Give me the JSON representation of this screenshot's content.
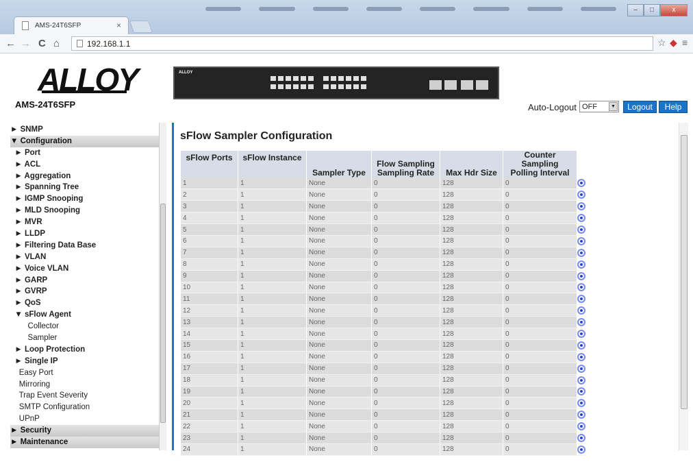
{
  "browser": {
    "tab_title": "AMS-24T6SFP",
    "tab_close": "×",
    "url": "192.168.1.1",
    "back_icon": "←",
    "forward_icon": "→",
    "reload_icon": "C",
    "home_icon": "⌂",
    "star_icon": "☆",
    "menu_icon": "≡",
    "win_min": "–",
    "win_max": "□",
    "win_close": "x"
  },
  "header": {
    "logo_text": "ALLOY",
    "model": "AMS-24T6SFP",
    "device_logo": "ALLOY",
    "autologout_label": "Auto-Logout",
    "autologout_value": "OFF",
    "logout_label": "Logout",
    "help_label": "Help"
  },
  "sidebar": {
    "items": [
      {
        "label": "► SNMP",
        "style": "b"
      },
      {
        "label": "▼ Configuration",
        "style": "b band"
      },
      {
        "label": "  ► Port",
        "style": "b"
      },
      {
        "label": "  ► ACL",
        "style": "b"
      },
      {
        "label": "  ► Aggregation",
        "style": "b"
      },
      {
        "label": "  ► Spanning Tree",
        "style": "b"
      },
      {
        "label": "  ► IGMP Snooping",
        "style": "b"
      },
      {
        "label": "  ► MLD Snooping",
        "style": "b"
      },
      {
        "label": "  ► MVR",
        "style": "b"
      },
      {
        "label": "  ► LLDP",
        "style": "b"
      },
      {
        "label": "  ► Filtering Data Base",
        "style": "b"
      },
      {
        "label": "  ► VLAN",
        "style": "b"
      },
      {
        "label": "  ► Voice VLAN",
        "style": "b"
      },
      {
        "label": "  ► GARP",
        "style": "b"
      },
      {
        "label": "  ► GVRP",
        "style": "b"
      },
      {
        "label": "  ► QoS",
        "style": "b"
      },
      {
        "label": "  ▼ sFlow Agent",
        "style": "b"
      },
      {
        "label": "        Collector",
        "style": ""
      },
      {
        "label": "        Sampler",
        "style": ""
      },
      {
        "label": "  ► Loop Protection",
        "style": "b"
      },
      {
        "label": "  ► Single IP",
        "style": "b"
      },
      {
        "label": "    Easy Port",
        "style": ""
      },
      {
        "label": "    Mirroring",
        "style": ""
      },
      {
        "label": "    Trap Event Severity",
        "style": ""
      },
      {
        "label": "    SMTP Configuration",
        "style": ""
      },
      {
        "label": "    UPnP",
        "style": ""
      },
      {
        "label": "► Security",
        "style": "b band"
      },
      {
        "label": "► Maintenance",
        "style": "b band"
      }
    ]
  },
  "main": {
    "title": "sFlow Sampler Configuration",
    "columns": [
      {
        "line1": "sFlow Ports",
        "line2": ""
      },
      {
        "line1": "sFlow Instance",
        "line2": ""
      },
      {
        "line1": "",
        "line2": "Sampler Type"
      },
      {
        "line1": "Flow Sampling",
        "line2": "Sampling Rate"
      },
      {
        "line1": "",
        "line2": "Max Hdr Size"
      },
      {
        "line1": "Counter Sampling",
        "line2": "Polling Interval"
      }
    ],
    "rows": [
      [
        "1",
        "1",
        "None",
        "0",
        "128",
        "0"
      ],
      [
        "2",
        "1",
        "None",
        "0",
        "128",
        "0"
      ],
      [
        "3",
        "1",
        "None",
        "0",
        "128",
        "0"
      ],
      [
        "4",
        "1",
        "None",
        "0",
        "128",
        "0"
      ],
      [
        "5",
        "1",
        "None",
        "0",
        "128",
        "0"
      ],
      [
        "6",
        "1",
        "None",
        "0",
        "128",
        "0"
      ],
      [
        "7",
        "1",
        "None",
        "0",
        "128",
        "0"
      ],
      [
        "8",
        "1",
        "None",
        "0",
        "128",
        "0"
      ],
      [
        "9",
        "1",
        "None",
        "0",
        "128",
        "0"
      ],
      [
        "10",
        "1",
        "None",
        "0",
        "128",
        "0"
      ],
      [
        "11",
        "1",
        "None",
        "0",
        "128",
        "0"
      ],
      [
        "12",
        "1",
        "None",
        "0",
        "128",
        "0"
      ],
      [
        "13",
        "1",
        "None",
        "0",
        "128",
        "0"
      ],
      [
        "14",
        "1",
        "None",
        "0",
        "128",
        "0"
      ],
      [
        "15",
        "1",
        "None",
        "0",
        "128",
        "0"
      ],
      [
        "16",
        "1",
        "None",
        "0",
        "128",
        "0"
      ],
      [
        "17",
        "1",
        "None",
        "0",
        "128",
        "0"
      ],
      [
        "18",
        "1",
        "None",
        "0",
        "128",
        "0"
      ],
      [
        "19",
        "1",
        "None",
        "0",
        "128",
        "0"
      ],
      [
        "20",
        "1",
        "None",
        "0",
        "128",
        "0"
      ],
      [
        "21",
        "1",
        "None",
        "0",
        "128",
        "0"
      ],
      [
        "22",
        "1",
        "None",
        "0",
        "128",
        "0"
      ],
      [
        "23",
        "1",
        "None",
        "0",
        "128",
        "0"
      ],
      [
        "24",
        "1",
        "None",
        "0",
        "128",
        "0"
      ]
    ]
  },
  "colors": {
    "accent": "#1b74c6",
    "edit_icon": "#2c3fd9",
    "header_cell": "#d7dde6",
    "cell": "#dcdcdc"
  }
}
